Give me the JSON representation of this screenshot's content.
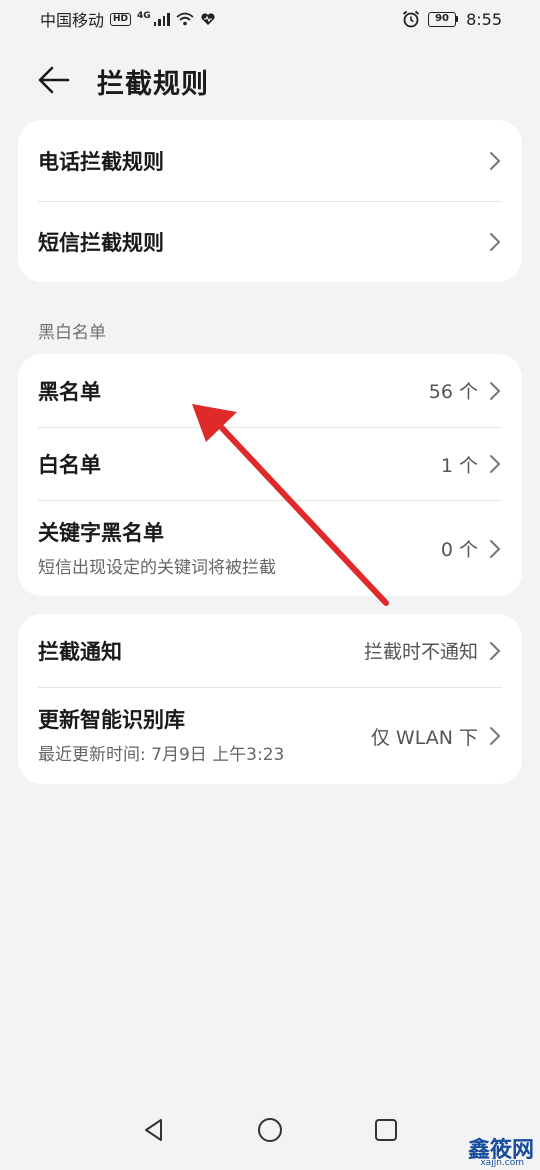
{
  "status_bar": {
    "carrier": "中国移动",
    "hd": "HD",
    "network": "4G",
    "battery": "90",
    "time": "8:55"
  },
  "header": {
    "title": "拦截规则",
    "back_icon": "arrow-left-icon"
  },
  "rules_card": {
    "items": [
      {
        "label": "电话拦截规则"
      },
      {
        "label": "短信拦截规则"
      }
    ]
  },
  "blacklist_section": {
    "label": "黑白名单",
    "items": [
      {
        "label": "黑名单",
        "value": "56 个"
      },
      {
        "label": "白名单",
        "value": "1 个"
      },
      {
        "label": "关键字黑名单",
        "subtitle": "短信出现设定的关键词将被拦截",
        "value": "0 个"
      }
    ]
  },
  "settings_card": {
    "items": [
      {
        "label": "拦截通知",
        "value": "拦截时不通知"
      },
      {
        "label": "更新智能识别库",
        "subtitle": "最近更新时间: 7月9日 上午3:23",
        "value": "仅 WLAN 下"
      }
    ]
  },
  "annotation": {
    "arrow_color": "#e02a2a"
  },
  "watermark": {
    "text": "鑫筱网",
    "sub": "xajjn.com"
  }
}
